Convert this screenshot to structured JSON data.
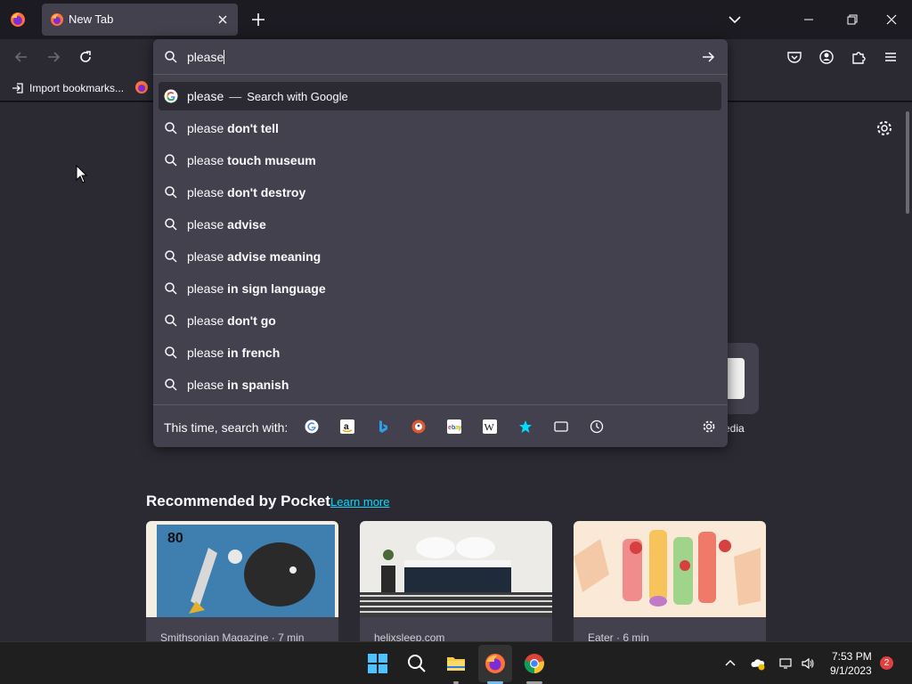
{
  "tabs": [
    {
      "title": "New Tab",
      "active": true
    }
  ],
  "urlbar": {
    "query": "please",
    "suggestions": [
      {
        "prefix": "please",
        "bold": "",
        "action": "Search with Google",
        "type": "google",
        "selected": true
      },
      {
        "prefix": "please",
        "bold": "don't tell"
      },
      {
        "prefix": "please",
        "bold": "touch museum"
      },
      {
        "prefix": "please",
        "bold": "don't destroy"
      },
      {
        "prefix": "please",
        "bold": "advise"
      },
      {
        "prefix": "please",
        "bold": "advise meaning"
      },
      {
        "prefix": "please",
        "bold": "in sign language"
      },
      {
        "prefix": "please",
        "bold": "don't go"
      },
      {
        "prefix": "please",
        "bold": "in french"
      },
      {
        "prefix": "please",
        "bold": "in spanish"
      }
    ],
    "search_with_label": "This time, search with:",
    "engines": [
      "google-icon",
      "amazon-icon",
      "bing-icon",
      "duckduckgo-icon",
      "ebay-icon",
      "wikipedia-icon",
      "bookmarks-star-icon",
      "tabs-icon",
      "history-clock-icon"
    ]
  },
  "bookmarks": {
    "import_label": "Import bookmarks..."
  },
  "content": {
    "shortcut_label": "edia",
    "pocket_title": "Recommended by Pocket",
    "pocket_learn_more": "Learn more",
    "cards": [
      {
        "source": "Smithsonian Magazine · 7 min"
      },
      {
        "source": "helixsleep.com"
      },
      {
        "source": "Eater · 6 min"
      }
    ]
  },
  "taskbar": {
    "time": "7:53 PM",
    "date": "9/1/2023",
    "notifications": "2"
  },
  "colors": {
    "accent": "#00ddff",
    "panel": "#42414d",
    "background": "#2b2a33"
  }
}
